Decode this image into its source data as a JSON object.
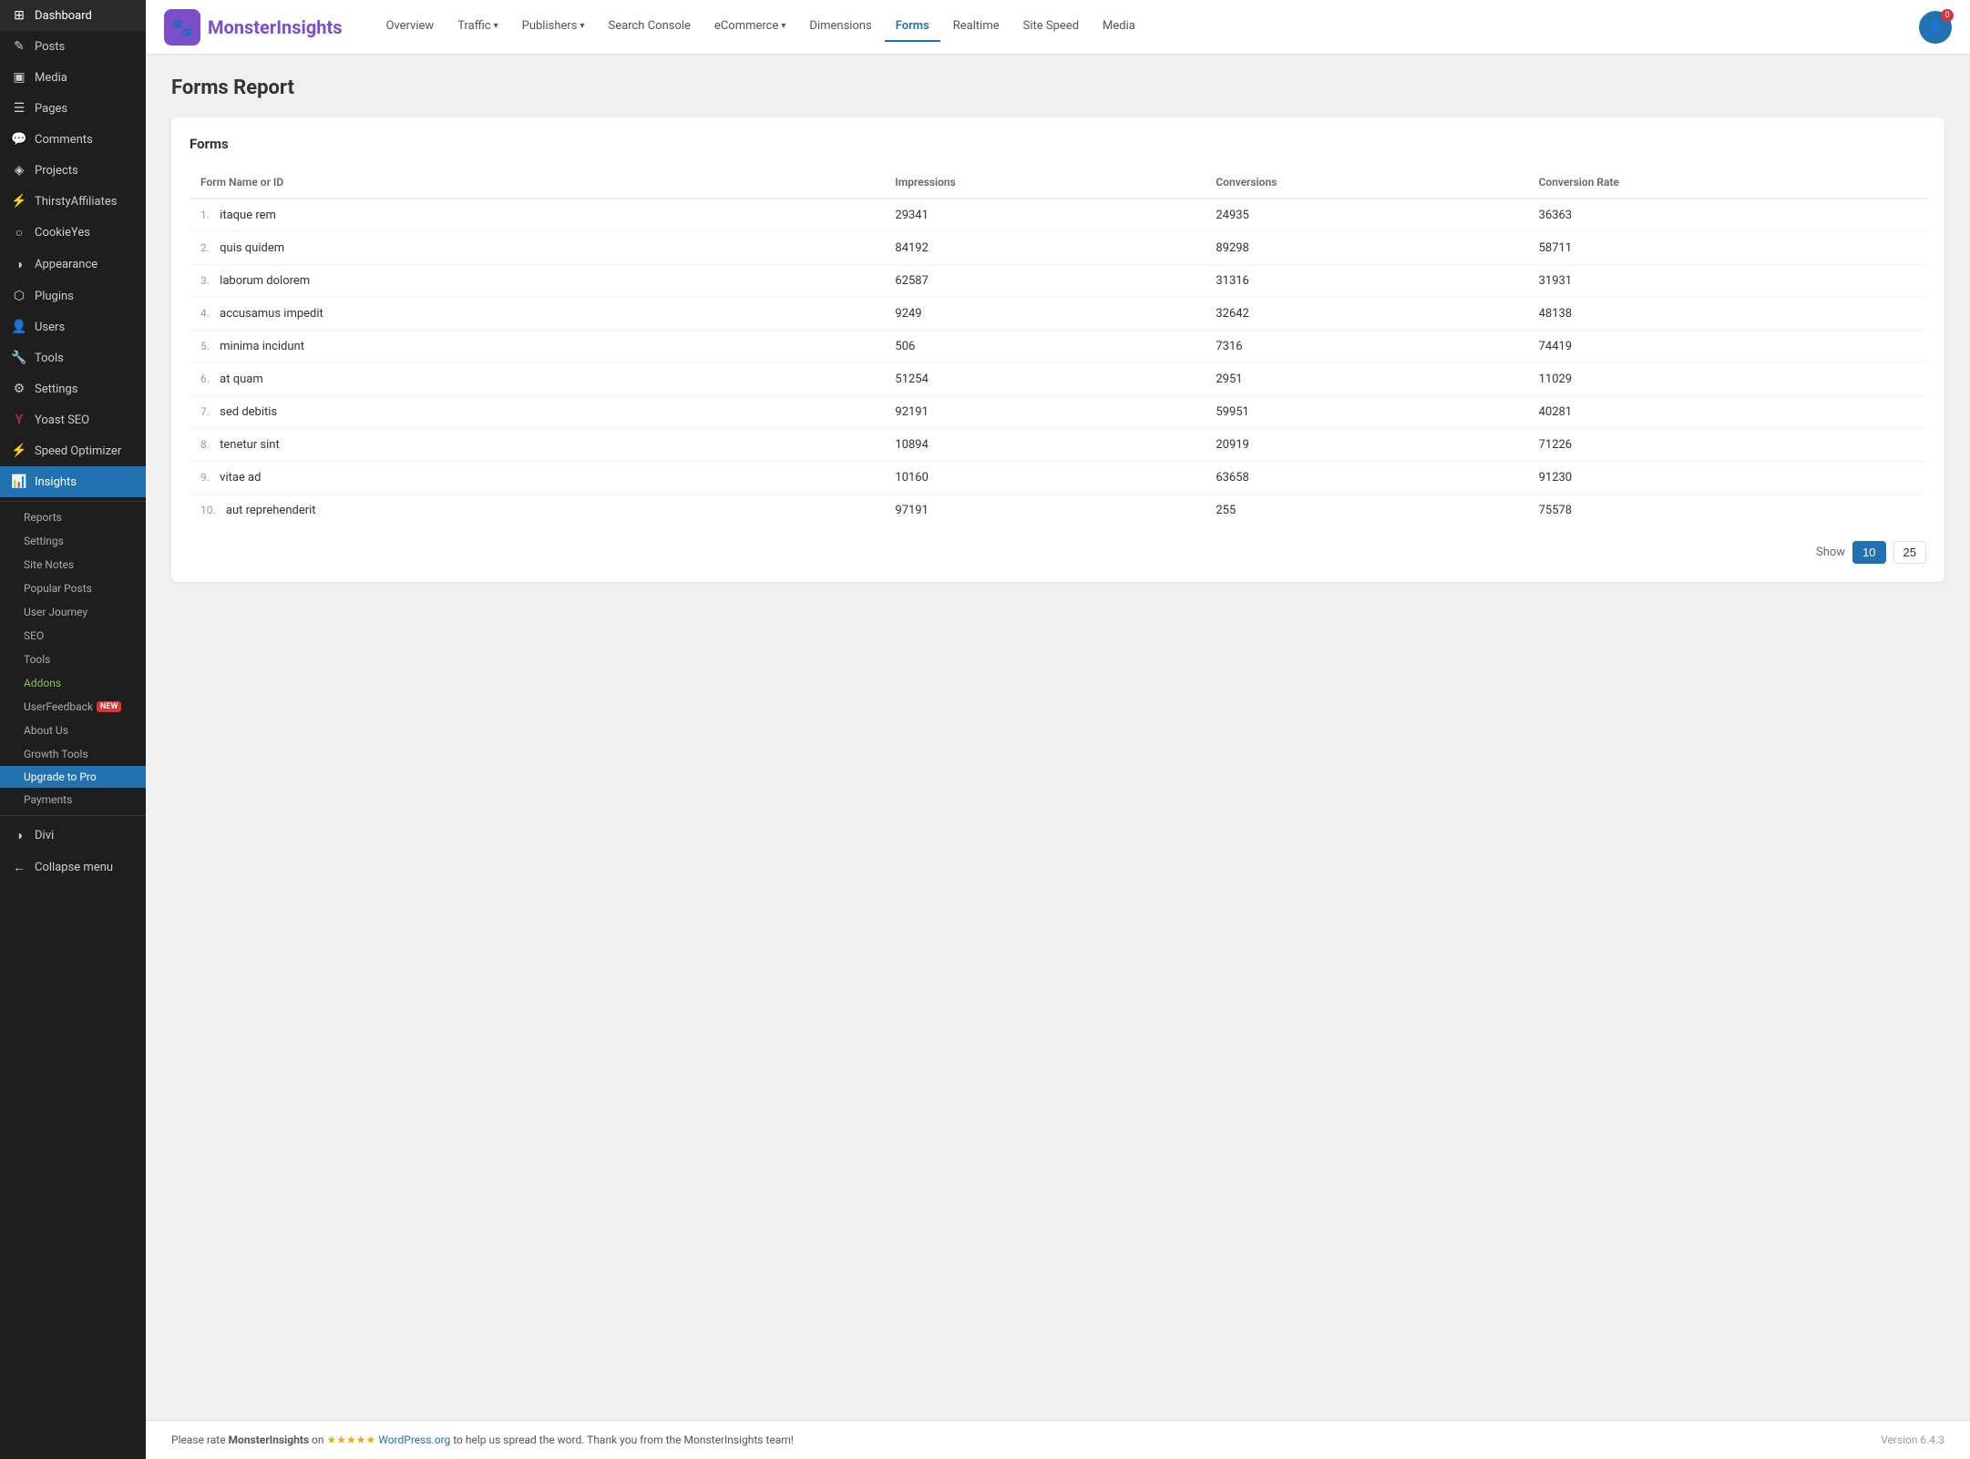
{
  "sidebar": {
    "items": [
      {
        "id": "dashboard",
        "label": "Dashboard",
        "icon": "⊞"
      },
      {
        "id": "posts",
        "label": "Posts",
        "icon": "✎"
      },
      {
        "id": "media",
        "label": "Media",
        "icon": "▣"
      },
      {
        "id": "pages",
        "label": "Pages",
        "icon": "☰"
      },
      {
        "id": "comments",
        "label": "Comments",
        "icon": "💬"
      },
      {
        "id": "projects",
        "label": "Projects",
        "icon": "◈"
      },
      {
        "id": "thirstyaffiliates",
        "label": "ThirstyAffiliates",
        "icon": "⚡"
      },
      {
        "id": "cookieyes",
        "label": "CookieYes",
        "icon": "○"
      },
      {
        "id": "appearance",
        "label": "Appearance",
        "icon": "◑"
      },
      {
        "id": "plugins",
        "label": "Plugins",
        "icon": "⬡"
      },
      {
        "id": "users",
        "label": "Users",
        "icon": "👤"
      },
      {
        "id": "tools",
        "label": "Tools",
        "icon": "🔧"
      },
      {
        "id": "settings",
        "label": "Settings",
        "icon": "⚙"
      },
      {
        "id": "yoastseo",
        "label": "Yoast SEO",
        "icon": "Y"
      },
      {
        "id": "speedoptimizer",
        "label": "Speed Optimizer",
        "icon": "⚡"
      },
      {
        "id": "insights",
        "label": "Insights",
        "icon": "📊",
        "active": true
      }
    ],
    "sub_items": [
      {
        "id": "reports",
        "label": "Reports"
      },
      {
        "id": "settings",
        "label": "Settings"
      },
      {
        "id": "site-notes",
        "label": "Site Notes"
      },
      {
        "id": "popular-posts",
        "label": "Popular Posts"
      },
      {
        "id": "user-journey",
        "label": "User Journey"
      },
      {
        "id": "seo",
        "label": "SEO"
      },
      {
        "id": "tools",
        "label": "Tools"
      },
      {
        "id": "addons",
        "label": "Addons",
        "highlight": true
      },
      {
        "id": "userfeedback",
        "label": "UserFeedback",
        "badge": "NEW"
      },
      {
        "id": "about-us",
        "label": "About Us"
      },
      {
        "id": "growth-tools",
        "label": "Growth Tools"
      },
      {
        "id": "upgrade",
        "label": "Upgrade to Pro",
        "upgrade": true
      },
      {
        "id": "payments",
        "label": "Payments"
      }
    ],
    "bottom": [
      {
        "id": "divi",
        "label": "Divi",
        "icon": "◑"
      },
      {
        "id": "collapse",
        "label": "Collapse menu",
        "icon": "←"
      }
    ]
  },
  "topbar": {
    "logo_text_normal": "Monster",
    "logo_text_colored": "Insights",
    "avatar_notif": "0",
    "nav_tabs": [
      {
        "id": "overview",
        "label": "Overview",
        "has_arrow": false
      },
      {
        "id": "traffic",
        "label": "Traffic",
        "has_arrow": true
      },
      {
        "id": "publishers",
        "label": "Publishers",
        "has_arrow": true
      },
      {
        "id": "search-console",
        "label": "Search Console",
        "has_arrow": false
      },
      {
        "id": "ecommerce",
        "label": "eCommerce",
        "has_arrow": true
      },
      {
        "id": "dimensions",
        "label": "Dimensions",
        "has_arrow": false
      },
      {
        "id": "forms",
        "label": "Forms",
        "has_arrow": false,
        "active": true
      },
      {
        "id": "realtime",
        "label": "Realtime",
        "has_arrow": false
      },
      {
        "id": "site-speed",
        "label": "Site Speed",
        "has_arrow": false
      },
      {
        "id": "media",
        "label": "Media",
        "has_arrow": false
      }
    ]
  },
  "page": {
    "title": "Forms Report",
    "card_title": "Forms",
    "table": {
      "columns": [
        {
          "id": "name",
          "label": "Form Name or ID"
        },
        {
          "id": "impressions",
          "label": "Impressions"
        },
        {
          "id": "conversions",
          "label": "Conversions"
        },
        {
          "id": "conversion_rate",
          "label": "Conversion Rate"
        }
      ],
      "rows": [
        {
          "num": 1,
          "name": "itaque rem",
          "impressions": "29341",
          "conversions": "24935",
          "conversion_rate": "36363"
        },
        {
          "num": 2,
          "name": "quis quidem",
          "impressions": "84192",
          "conversions": "89298",
          "conversion_rate": "58711"
        },
        {
          "num": 3,
          "name": "laborum dolorem",
          "impressions": "62587",
          "conversions": "31316",
          "conversion_rate": "31931"
        },
        {
          "num": 4,
          "name": "accusamus impedit",
          "impressions": "9249",
          "conversions": "32642",
          "conversion_rate": "48138"
        },
        {
          "num": 5,
          "name": "minima incidunt",
          "impressions": "506",
          "conversions": "7316",
          "conversion_rate": "74419"
        },
        {
          "num": 6,
          "name": "at quam",
          "impressions": "51254",
          "conversions": "2951",
          "conversion_rate": "11029"
        },
        {
          "num": 7,
          "name": "sed debitis",
          "impressions": "92191",
          "conversions": "59951",
          "conversion_rate": "40281"
        },
        {
          "num": 8,
          "name": "tenetur sint",
          "impressions": "10894",
          "conversions": "20919",
          "conversion_rate": "71226"
        },
        {
          "num": 9,
          "name": "vitae ad",
          "impressions": "10160",
          "conversions": "63658",
          "conversion_rate": "91230"
        },
        {
          "num": 10,
          "name": "aut reprehenderit",
          "impressions": "97191",
          "conversions": "255",
          "conversion_rate": "75578"
        }
      ]
    },
    "pagination": {
      "show_label": "Show",
      "options": [
        "10",
        "25"
      ],
      "active": "10"
    }
  },
  "footer": {
    "text_before": "Please rate ",
    "brand": "MonsterInsights",
    "text_middle": " on ",
    "stars": "★★★★★",
    "link_text": "WordPress.org",
    "link_url": "#",
    "text_after": " to help us spread the word. Thank you from the MonsterInsights team!",
    "version": "Version 6.4.3"
  }
}
